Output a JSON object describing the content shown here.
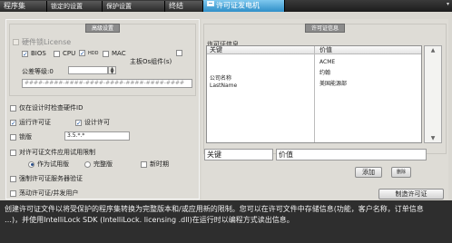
{
  "tabs": [
    {
      "label": "程序集"
    },
    {
      "label": "锁定的设置"
    },
    {
      "label": "保护设置"
    },
    {
      "label": "终结"
    },
    {
      "label": "许可证发电机"
    }
  ],
  "hardware_lock": {
    "group_title": "高级设置",
    "enable_label": "硬件锁License",
    "options": {
      "bios": "BIOS",
      "cpu": "CPU",
      "hdd": "HDD",
      "mac": "MAC",
      "host_os": "主板Os组件(s)"
    },
    "tolerance_label": "公差等级:0",
    "hardware_id_placeholder": "####-####-####-####-####-####-####-####"
  },
  "options": {
    "check_hardware_id": "仅在设计时检查硬件ID",
    "runtime_license": "运行许可证",
    "design_license": "设计许可",
    "lock_label": "锁版",
    "lock_value": "3.5.*.*",
    "trial_enable": "对许可证文件应用试用限制",
    "as_trial": "作为试用版",
    "full_version": "完整版",
    "new_period": "新时期",
    "enforce_server": "强制许可证服务器验证",
    "floating": "荡动许可证/并发用户"
  },
  "license_info": {
    "group_title": "许可证信息",
    "section_label": "许可证信息",
    "columns": [
      "关键",
      "价值"
    ],
    "rows": [
      {
        "key": "",
        "value": "ACME"
      },
      {
        "key": "公司名称",
        "value": "约翰"
      },
      {
        "key": "LastName",
        "value": "美国能源部"
      }
    ],
    "key_input": "关键",
    "value_input": "价值",
    "add_button": "添加",
    "delete_button": "删除",
    "generate_button": "制造许可证"
  },
  "footer": {
    "line1": "创建许可证文件以将受保护的程序集转换为完整版本和/或应用新的限制。您可以在许可文件中存储信息(功能，客户名称，订单信息",
    "line2": "…)，并使用IntelliLock SDK (IntelliLock. licensing .dll)在运行时以编程方式读出信息。"
  }
}
